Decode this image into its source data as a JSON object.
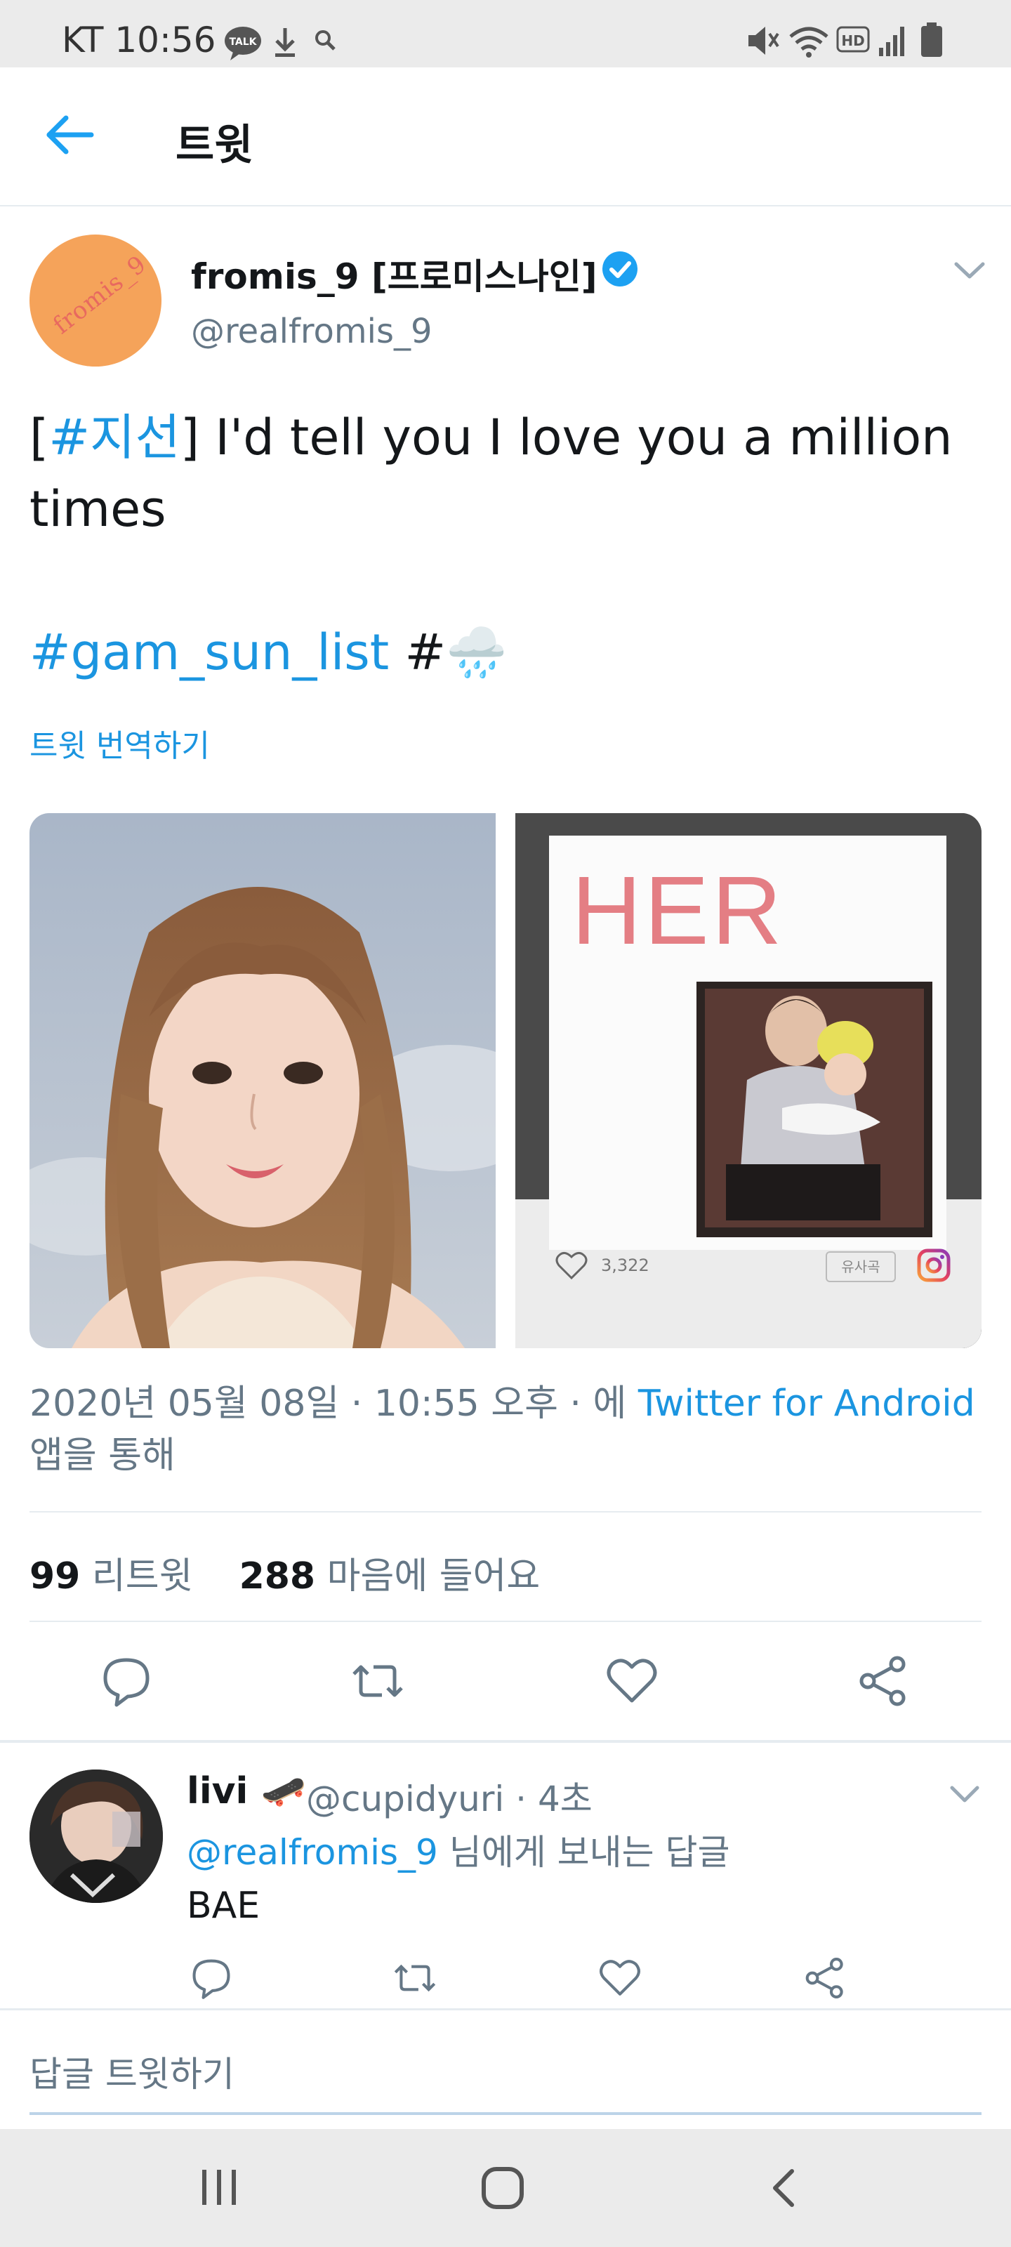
{
  "status_bar": {
    "time": "KT 10:56",
    "left_icons": [
      "talk-icon",
      "download-icon",
      "search-icon"
    ],
    "right_icons": [
      "mute-icon",
      "wifi-icon",
      "hd-icon",
      "signal-icon",
      "battery-icon"
    ],
    "hd_label": "HD",
    "talk_label": "TALK"
  },
  "header": {
    "title": "트윗",
    "back_icon": "back-arrow-icon"
  },
  "tweet": {
    "author_name": "fromis_9 [프로미스나인]",
    "author_handle": "@realfromis_9",
    "avatar_logo": "fromis_9",
    "text_line1_bracket_open": "[",
    "text_hashtag1": "#지선",
    "text_line1_rest": "] I'd tell you I love you a million",
    "text_line2": "times",
    "text_hashtag2": "#gam_sun_list",
    "text_hash_symbol": " #",
    "emoji": "🌧️",
    "translate": "트윗 번역하기",
    "media": {
      "image2_title": "HER",
      "image2_likes": "3,322",
      "image2_tag": "유사곡"
    },
    "timestamp_prefix": "2020년 05월 08일 · 10:55 오후 · 에 ",
    "timestamp_source": "Twitter for Android",
    "timestamp_suffix": "앱을 통해",
    "retweets_count": "99",
    "retweets_label": "리트윗",
    "likes_count": "288",
    "likes_label": "마음에 들어요",
    "colors": {
      "link": "#1b95e0",
      "verified": "#1da1f2",
      "secondary": "#657786"
    }
  },
  "reply": {
    "name": "livi",
    "name_emoji": "🛹",
    "handle_time": "@cupidyuri · 4초",
    "reply_to_handle": "@realfromis_9",
    "reply_to_suffix": " 님에게 보내는 답글",
    "text": "BAE"
  },
  "compose": {
    "placeholder": "답글 트윗하기"
  }
}
